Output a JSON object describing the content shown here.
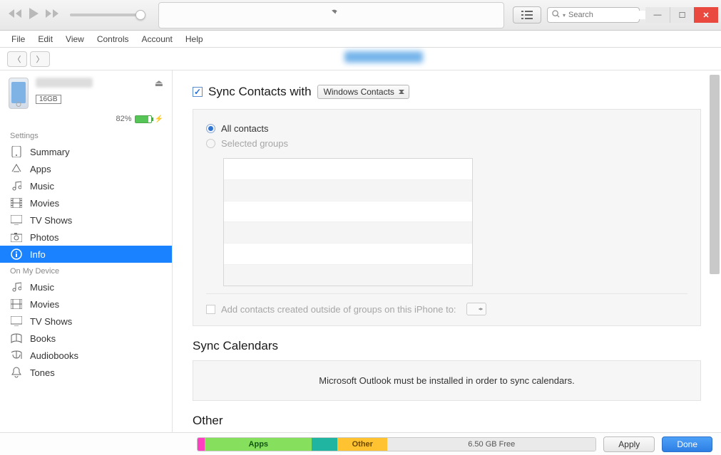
{
  "search": {
    "placeholder": "Search"
  },
  "menu": {
    "file": "File",
    "edit": "Edit",
    "view": "View",
    "controls": "Controls",
    "account": "Account",
    "help": "Help"
  },
  "device": {
    "capacity": "16GB",
    "battery_pct": "82%"
  },
  "sidebar": {
    "settings_header": "Settings",
    "on_device_header": "On My Device",
    "settings": [
      {
        "label": "Summary"
      },
      {
        "label": "Apps"
      },
      {
        "label": "Music"
      },
      {
        "label": "Movies"
      },
      {
        "label": "TV Shows"
      },
      {
        "label": "Photos"
      },
      {
        "label": "Info"
      }
    ],
    "on_device": [
      {
        "label": "Music"
      },
      {
        "label": "Movies"
      },
      {
        "label": "TV Shows"
      },
      {
        "label": "Books"
      },
      {
        "label": "Audiobooks"
      },
      {
        "label": "Tones"
      }
    ]
  },
  "sync_contacts": {
    "label": "Sync Contacts with",
    "dropdown": "Windows Contacts",
    "radio_all": "All contacts",
    "radio_groups": "Selected groups",
    "outside_label": "Add contacts created outside of groups on this iPhone to:"
  },
  "sync_calendars": {
    "header": "Sync Calendars",
    "message": "Microsoft Outlook must be installed in order to sync calendars."
  },
  "other": {
    "header": "Other"
  },
  "storage": {
    "apps": "Apps",
    "other": "Other",
    "free": "6.50 GB Free"
  },
  "buttons": {
    "apply": "Apply",
    "done": "Done"
  }
}
